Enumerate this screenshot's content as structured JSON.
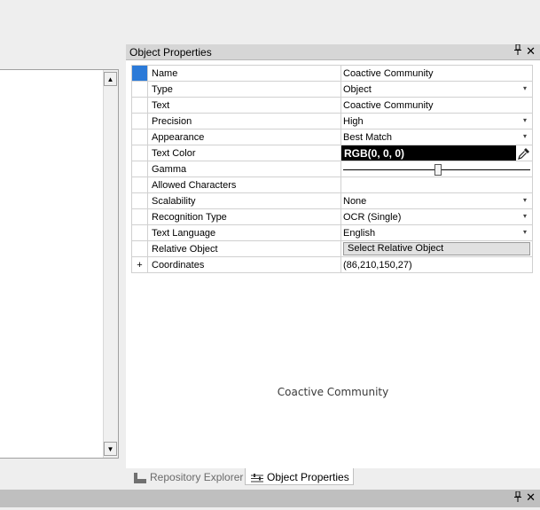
{
  "panel": {
    "title": "Object Properties",
    "pin_glyph": "📌",
    "close_glyph": "✕"
  },
  "properties": [
    {
      "name": "Name",
      "value": "Coactive Community",
      "editor": "text",
      "selected": true
    },
    {
      "name": "Type",
      "value": "Object",
      "editor": "dropdown"
    },
    {
      "name": "Text",
      "value": "Coactive Community",
      "editor": "text"
    },
    {
      "name": "Precision",
      "value": "High",
      "editor": "dropdown"
    },
    {
      "name": "Appearance",
      "value": "Best Match",
      "editor": "dropdown"
    },
    {
      "name": "Text Color",
      "value": "RGB(0, 0, 0)",
      "editor": "color",
      "swatch": "#000000"
    },
    {
      "name": "Gamma",
      "value": "",
      "editor": "slider",
      "level": 0.5
    },
    {
      "name": "Allowed Characters",
      "value": "",
      "editor": "text"
    },
    {
      "name": "Scalability",
      "value": "None",
      "editor": "dropdown"
    },
    {
      "name": "Recognition Type",
      "value": "OCR (Single)",
      "editor": "dropdown"
    },
    {
      "name": "Text Language",
      "value": "English",
      "editor": "dropdown"
    },
    {
      "name": "Relative Object",
      "value": "Select Relative Object",
      "editor": "button"
    },
    {
      "name": "Coordinates",
      "value": "(86,210,150,27)",
      "editor": "text",
      "expander": "+"
    }
  ],
  "description": "Coactive Community",
  "tabs": [
    {
      "label": "Repository Explorer",
      "icon": "repository-icon",
      "active": false
    },
    {
      "label": "Object Properties",
      "icon": "properties-icon",
      "active": true
    }
  ],
  "icons": {
    "dropdown": "▾",
    "scroll_up": "▲",
    "scroll_down": "▼"
  },
  "colors": {
    "selection": "#2b7ad8",
    "title_bar": "#d6d6d6",
    "color_swatch": "#000000"
  }
}
